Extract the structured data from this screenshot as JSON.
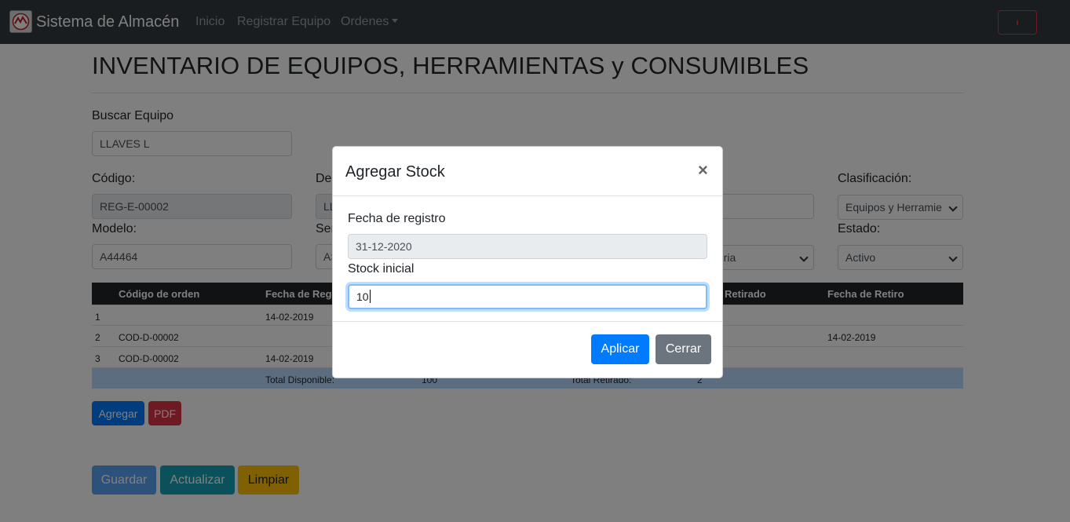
{
  "navbar": {
    "brand": "Sistema de Almacén",
    "links": [
      "Inicio",
      "Registrar Equipo",
      "Ordenes"
    ],
    "logo_icon": "warehouse-logo-icon"
  },
  "page": {
    "title": "INVENTARIO DE EQUIPOS, HERRAMIENTAS y CONSUMIBLES",
    "search_label": "Buscar Equipo",
    "search_value": "LLAVES L",
    "codigo_label": "Código:",
    "codigo_value": "REG-E-00002",
    "desc_label": "Des",
    "desc_value": "LL",
    "modelo_label": "Modelo:",
    "modelo_value": "A44464",
    "serie_label": "Ser",
    "serie_value": "AS",
    "categoria_value": "teria",
    "clasificacion_label": "Clasificación:",
    "clasificacion_value": "Equipos y Herramie",
    "estado_label": "Estado:",
    "estado_value": "Activo"
  },
  "table": {
    "headers": [
      "Código de orden",
      "Fecha de Regist",
      "Retirado",
      "Fecha de Retiro"
    ],
    "rows": [
      {
        "num": "1",
        "codigo": "",
        "fecha_reg": "14-02-2019",
        "fecha_ret": ""
      },
      {
        "num": "2",
        "codigo": "COD-D-00002",
        "fecha_reg": "",
        "fecha_ret": "14-02-2019"
      },
      {
        "num": "3",
        "codigo": "COD-D-00002",
        "fecha_reg": "14-02-2019",
        "fecha_ret": ""
      }
    ],
    "total_disponible_label": "Total Disponible:",
    "total_disponible_value": "100",
    "total_retirado_label": "Total Retirado:",
    "total_retirado_value": "2"
  },
  "actions": {
    "agregar": "Agregar",
    "pdf": "PDF",
    "guardar": "Guardar",
    "actualizar": "Actualizar",
    "limpiar": "Limpiar"
  },
  "modal": {
    "title": "Agregar Stock",
    "close": "×",
    "fecha_label": "Fecha de registro",
    "fecha_value": "31-12-2020",
    "stock_label": "Stock inicial",
    "stock_value": "10",
    "aplicar": "Aplicar",
    "cerrar": "Cerrar"
  },
  "colors": {
    "navbar": "#343a40",
    "primary": "#007bff",
    "danger": "#dc3545",
    "info": "#17a2b8",
    "warning": "#ffc107",
    "secondary": "#6c757d"
  }
}
